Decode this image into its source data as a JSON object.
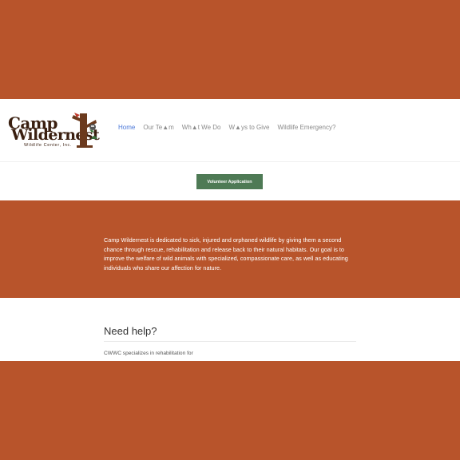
{
  "logo": {
    "line1": "Camp",
    "line2": "Wildernest",
    "sub": "Wildlife Center, Inc."
  },
  "nav": {
    "items": [
      "Home",
      "Our Te▲m",
      "Wh▲t We Do",
      "W▲ys to Give",
      "Wildlife Emergency?"
    ]
  },
  "volunteer_button": "Volunteer Application",
  "mission": "Camp Wildernest is dedicated to sick, injured and orphaned wildlife by giving them a second chance through rescue, rehabilitation and release back to their natural habitats. Our goal is to improve the welfare of wild animals with specialized, compassionate care, as well as educating individuals who share our affection for nature.",
  "help": {
    "title": "Need help?",
    "text": "CWWC specializes in rehabilitation for"
  },
  "colors": {
    "brand_orange": "#b8542b",
    "button_green": "#4e7a55",
    "nav_active": "#4a77d8"
  }
}
